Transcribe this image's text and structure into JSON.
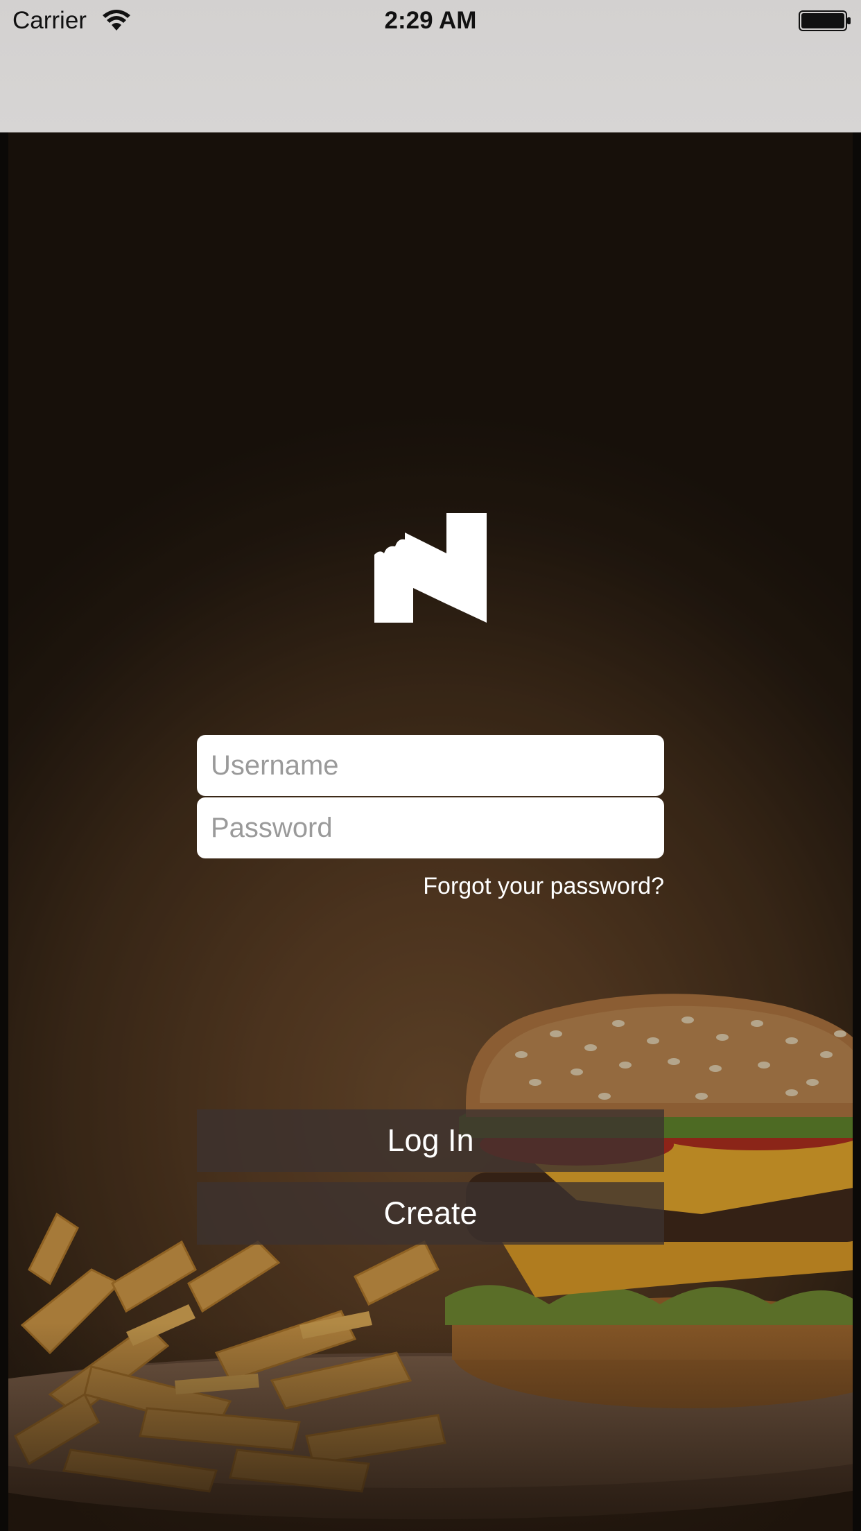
{
  "status_bar": {
    "carrier": "Carrier",
    "time": "2:29 AM",
    "wifi_icon": "wifi-icon",
    "battery_icon": "battery-full-icon"
  },
  "logo": {
    "icon": "bitten-n-logo-icon"
  },
  "login_form": {
    "username_placeholder": "Username",
    "password_placeholder": "Password",
    "username_value": "",
    "password_value": "",
    "forgot_link": "Forgot your password?",
    "login_button": "Log In",
    "create_button": "Create"
  },
  "colors": {
    "nav_bar": "#d6d4d3",
    "field_background": "#ffffff",
    "button_background": "#3c3230",
    "text_light": "#ffffff"
  }
}
